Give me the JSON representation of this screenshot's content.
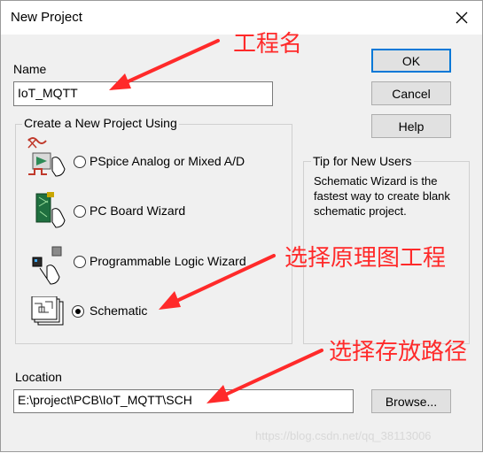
{
  "window": {
    "title": "New Project"
  },
  "name_field": {
    "label": "Name",
    "value": "IoT_MQTT"
  },
  "buttons": {
    "ok": "OK",
    "cancel": "Cancel",
    "help": "Help",
    "browse": "Browse..."
  },
  "project_group": {
    "label": "Create a New Project Using",
    "options": [
      {
        "label": "PSpice Analog or Mixed A/D",
        "selected": false,
        "icon": "pspice-icon"
      },
      {
        "label": "PC Board Wizard",
        "selected": false,
        "icon": "pcb-wizard-icon"
      },
      {
        "label": "Programmable Logic Wizard",
        "selected": false,
        "icon": "programmable-logic-icon"
      },
      {
        "label": "Schematic",
        "selected": true,
        "icon": "schematic-icon"
      }
    ]
  },
  "tip": {
    "label": "Tip for New Users",
    "text": "Schematic Wizard is the fastest way to create blank schematic project."
  },
  "location_field": {
    "label": "Location",
    "value": "E:\\project\\PCB\\IoT_MQTT\\SCH"
  },
  "annotations": {
    "project_name": "工程名",
    "select_schematic": "选择原理图工程",
    "select_location": "选择存放路径",
    "color": "#ff2a2a"
  },
  "watermark": "https://blog.csdn.net/qq_38113006"
}
